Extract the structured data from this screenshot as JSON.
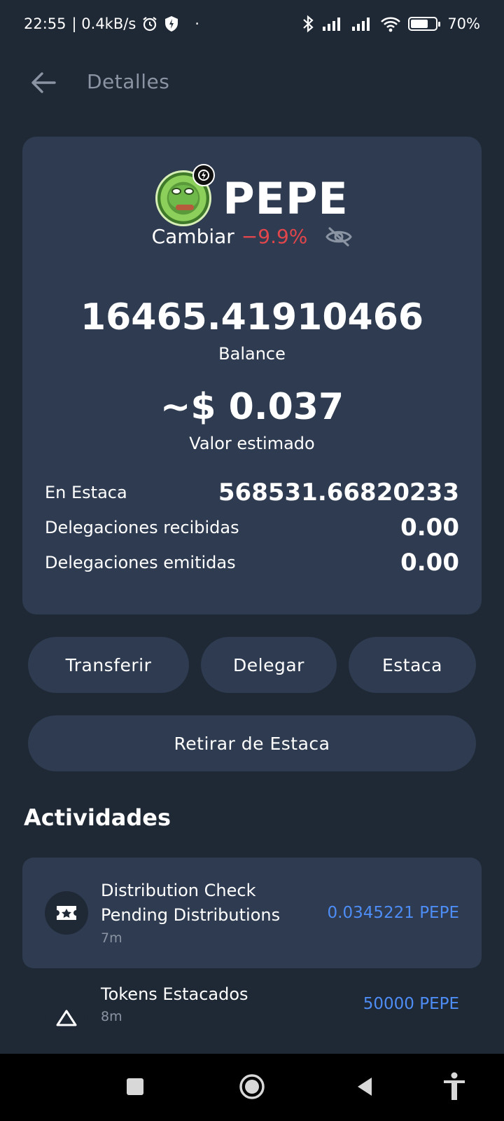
{
  "status_bar": {
    "time": "22:55",
    "network_speed": "| 0.4kB/s",
    "dot": "·",
    "battery": "70%",
    "battery_level": 0.7
  },
  "header": {
    "title": "Detalles"
  },
  "token": {
    "symbol": "PEPE",
    "change_label": "Cambiar",
    "change_value": "−9.9%",
    "balance": "16465.41910466",
    "balance_label": "Balance",
    "estimated_value": "~$ 0.037",
    "estimated_label": "Valor estimado",
    "stats": [
      {
        "label": "En Estaca",
        "value": "568531.66820233"
      },
      {
        "label": "Delegaciones recibidas",
        "value": "0.00"
      },
      {
        "label": "Delegaciones emitidas",
        "value": "0.00"
      }
    ]
  },
  "actions": {
    "transfer": "Transferir",
    "delegate": "Delegar",
    "stake": "Estaca",
    "unstake": "Retirar de Estaca"
  },
  "activities": {
    "title": "Actividades",
    "items": [
      {
        "title_line1": "Distribution Check",
        "title_line2": "Pending Distributions",
        "time": "7m",
        "amount": "0.0345221 PEPE",
        "icon": "ticket-star-icon"
      },
      {
        "title_line1": "Tokens Estacados",
        "time": "8m",
        "amount": "50000 PEPE",
        "icon": "triangle-icon"
      }
    ]
  },
  "colors": {
    "background": "#1f2835",
    "card": "#2e3b50",
    "negative": "#e0464b",
    "accent": "#4e8df5",
    "muted": "#8a94a3"
  }
}
